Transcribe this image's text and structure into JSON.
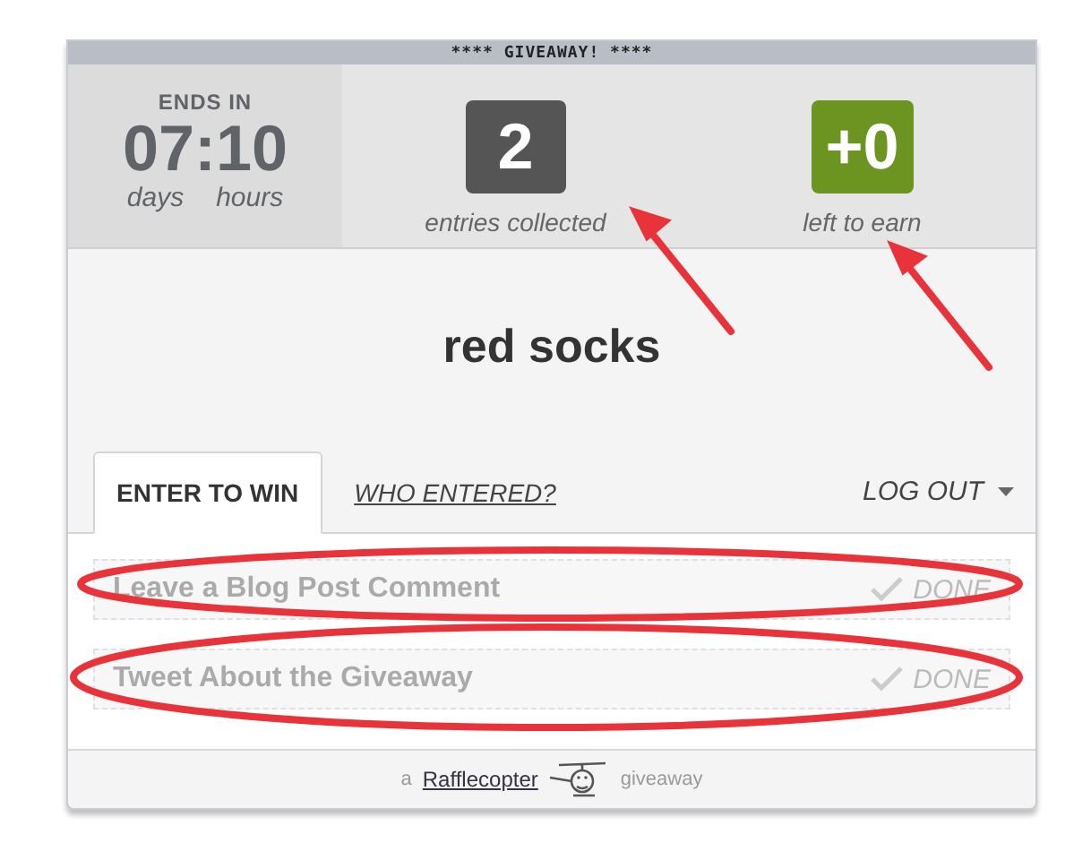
{
  "banner": {
    "title": "**** GIVEAWAY! ****"
  },
  "timer": {
    "label": "ENDS IN",
    "value": "07:10",
    "units": [
      "days",
      "hours"
    ]
  },
  "stats": [
    {
      "value": "2",
      "label": "entries collected",
      "color": "#555555"
    },
    {
      "value": "+0",
      "label": "left to earn",
      "color": "#6b9420"
    }
  ],
  "prize": {
    "title": "red socks"
  },
  "tabs": [
    {
      "label": "ENTER TO WIN",
      "kind": "tab",
      "selected": true
    },
    {
      "label": "WHO ENTERED?",
      "kind": "link",
      "selected": false
    }
  ],
  "account_menu": {
    "label": "LOG OUT"
  },
  "entries": [
    {
      "label": "Leave a Blog Post Comment",
      "status": "DONE",
      "done": true
    },
    {
      "label": "Tweet About the Giveaway",
      "status": "DONE",
      "done": true
    }
  ],
  "footer": {
    "prefix": "a",
    "link": "Rafflecopter",
    "suffix": "giveaway"
  }
}
